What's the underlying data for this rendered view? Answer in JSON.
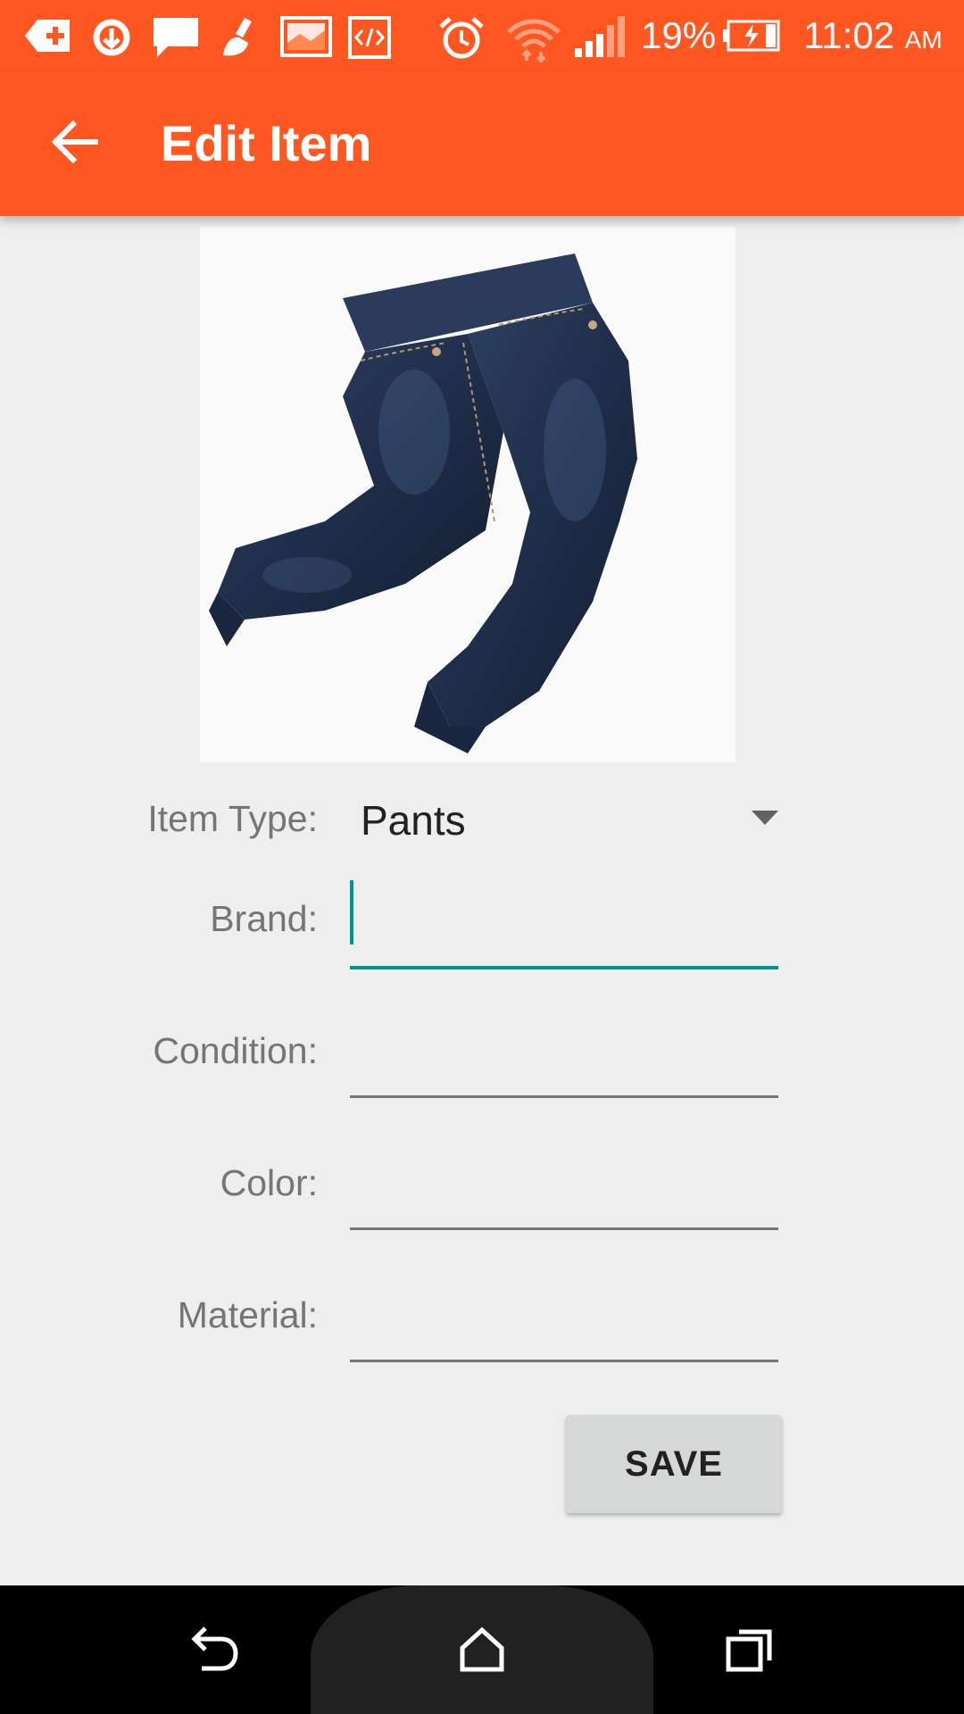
{
  "status_bar": {
    "battery_percent": "19%",
    "time": "11:02",
    "ampm": "AM",
    "icons": [
      "add-notification-icon",
      "sync-icon",
      "message-icon",
      "cleaner-icon",
      "image-icon",
      "code-icon",
      "alarm-icon",
      "wifi-icon",
      "signal-icon",
      "battery-charging-icon"
    ]
  },
  "app_bar": {
    "title": "Edit Item",
    "back_icon": "arrow-back-icon"
  },
  "item_image": {
    "subject": "jeans"
  },
  "form": {
    "item_type": {
      "label": "Item Type:",
      "value": "Pants"
    },
    "brand": {
      "label": "Brand:",
      "value": ""
    },
    "condition": {
      "label": "Condition:",
      "value": ""
    },
    "color": {
      "label": "Color:",
      "value": ""
    },
    "material": {
      "label": "Material:",
      "value": ""
    },
    "save_label": "SAVE"
  },
  "colors": {
    "primary": "#ff5722",
    "accent": "#009688",
    "background": "#eeeeee"
  },
  "nav_bar": {
    "icons": [
      "back-icon",
      "home-icon",
      "recents-icon"
    ]
  }
}
